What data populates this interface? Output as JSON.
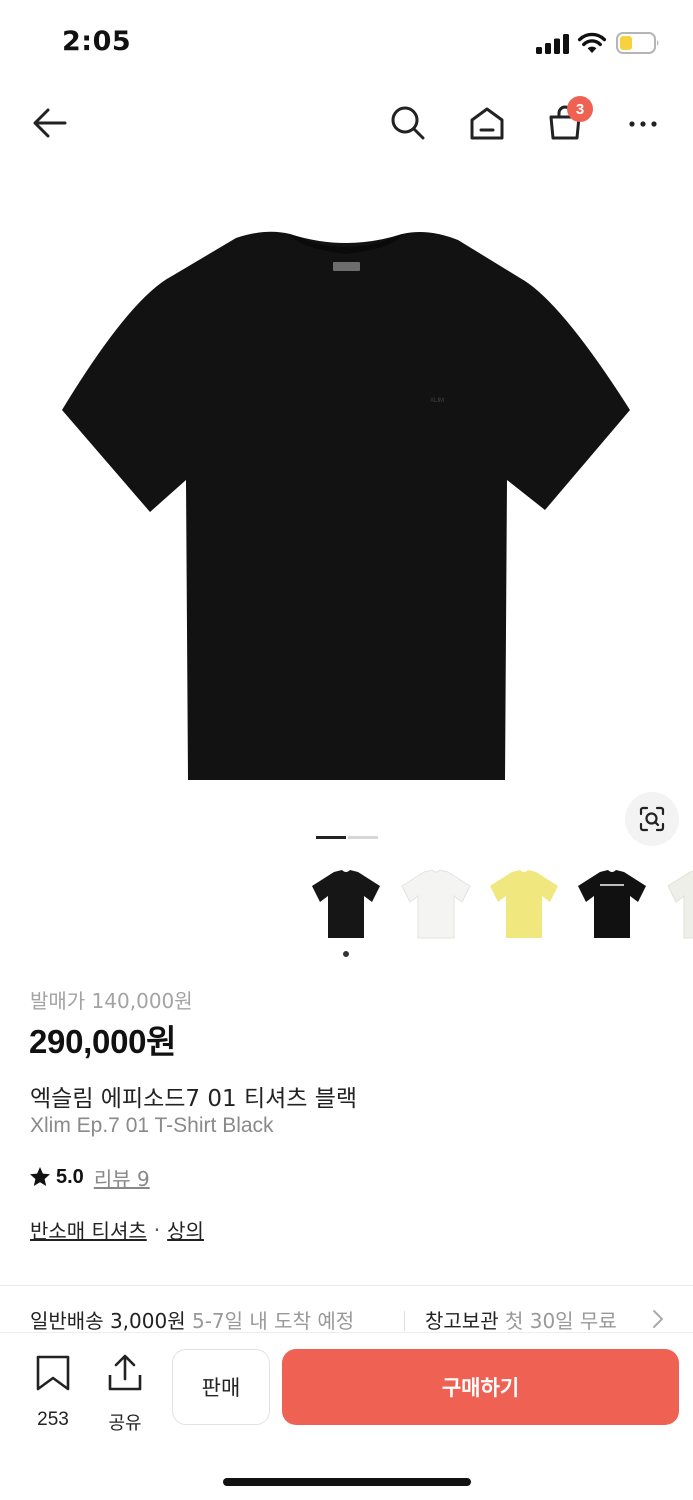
{
  "status_bar": {
    "time": "2:05",
    "signal_icon": "cellular-signal-icon",
    "wifi_icon": "wifi-icon",
    "battery_icon": "battery-low-icon",
    "battery_color": "#f7d23e"
  },
  "top_nav": {
    "back_icon": "arrow-left-icon",
    "search_icon": "search-icon",
    "home_icon": "home-icon",
    "cart_icon": "shopping-bag-icon",
    "cart_badge": "3",
    "more_icon": "more-dots-icon"
  },
  "product_image": {
    "description_icon": "black-tshirt-image",
    "zoom_icon": "image-search-icon",
    "pager_total": 2,
    "pager_active": 1
  },
  "thumbnails": [
    {
      "name": "black",
      "color": "#161616"
    },
    {
      "name": "white",
      "color": "#f4f4f2"
    },
    {
      "name": "yellow",
      "color": "#f1e77f"
    },
    {
      "name": "black-print",
      "color": "#111111"
    },
    {
      "name": "ivory",
      "color": "#efefea"
    }
  ],
  "product": {
    "release_price": "발매가 140,000원",
    "price": "290,000원",
    "name_ko": "엑슬림 에피소드7 01 티셔츠 블랙",
    "name_en": "Xlim Ep.7 01 T-Shirt Black",
    "rating": "5.0",
    "review_link": "리뷰 9",
    "category_1": "반소매 티셔츠",
    "category_sep": "·",
    "category_2": "상의"
  },
  "shipping": {
    "general_label": "일반배송 3,000원",
    "general_eta": "5-7일 내 도착 예정",
    "warehouse_label": "창고보관",
    "warehouse_note": "첫 30일 무료"
  },
  "bottom_bar": {
    "bookmark_count": "253",
    "share_label": "공유",
    "sell_label": "판매",
    "buy_label": "구매하기",
    "accent_color": "#ef6253"
  }
}
